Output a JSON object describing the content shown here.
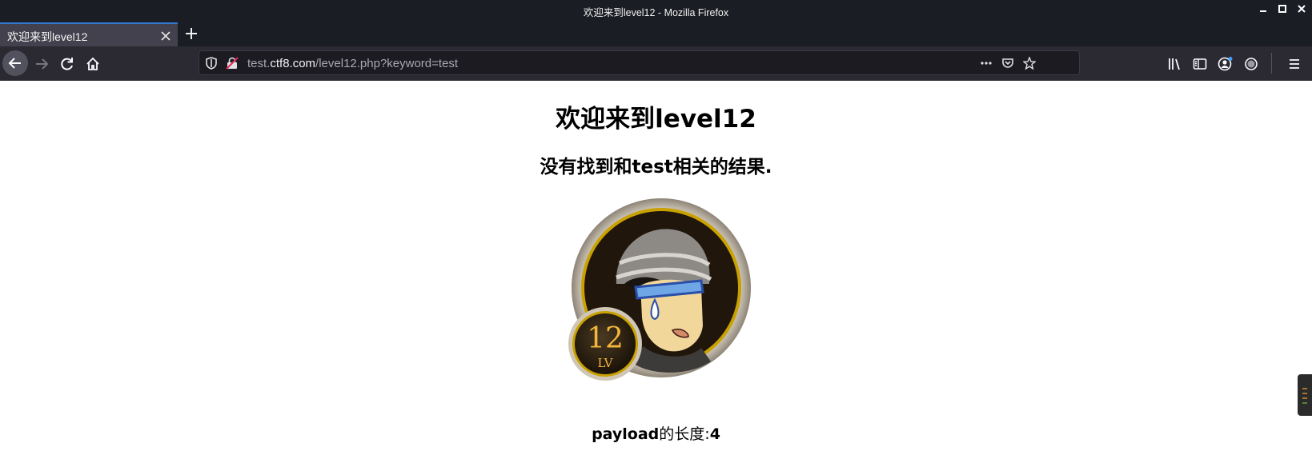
{
  "window": {
    "title": "欢迎来到level12 - Mozilla Firefox"
  },
  "tabs": [
    {
      "label": "欢迎来到level12"
    }
  ],
  "urlbar": {
    "scheme_prefix": "test.",
    "domain": "ctf8.com",
    "path": "/level12.php?keyword=test"
  },
  "page": {
    "title": "欢迎来到level12",
    "result_prefix": "没有找到和",
    "result_keyword": "test",
    "result_suffix": "相关的结果.",
    "badge_number": "12",
    "badge_lv": "LV",
    "payload_label": "payload",
    "payload_mid": "的长度:",
    "payload_len": "4"
  },
  "colors": {
    "titlebar": "#1b1d24",
    "toolbar": "#2b2a33",
    "tab_active": "#42414d",
    "accent": "#2e7ad1"
  },
  "icons": [
    "back-arrow-icon",
    "forward-arrow-icon",
    "reload-icon",
    "home-icon",
    "shield-icon",
    "insecure-lock-icon",
    "more-icon",
    "pocket-icon",
    "star-icon",
    "library-icon",
    "sidebar-icon",
    "account-icon",
    "extension-icon",
    "menu-icon",
    "close-icon",
    "plus-icon"
  ]
}
